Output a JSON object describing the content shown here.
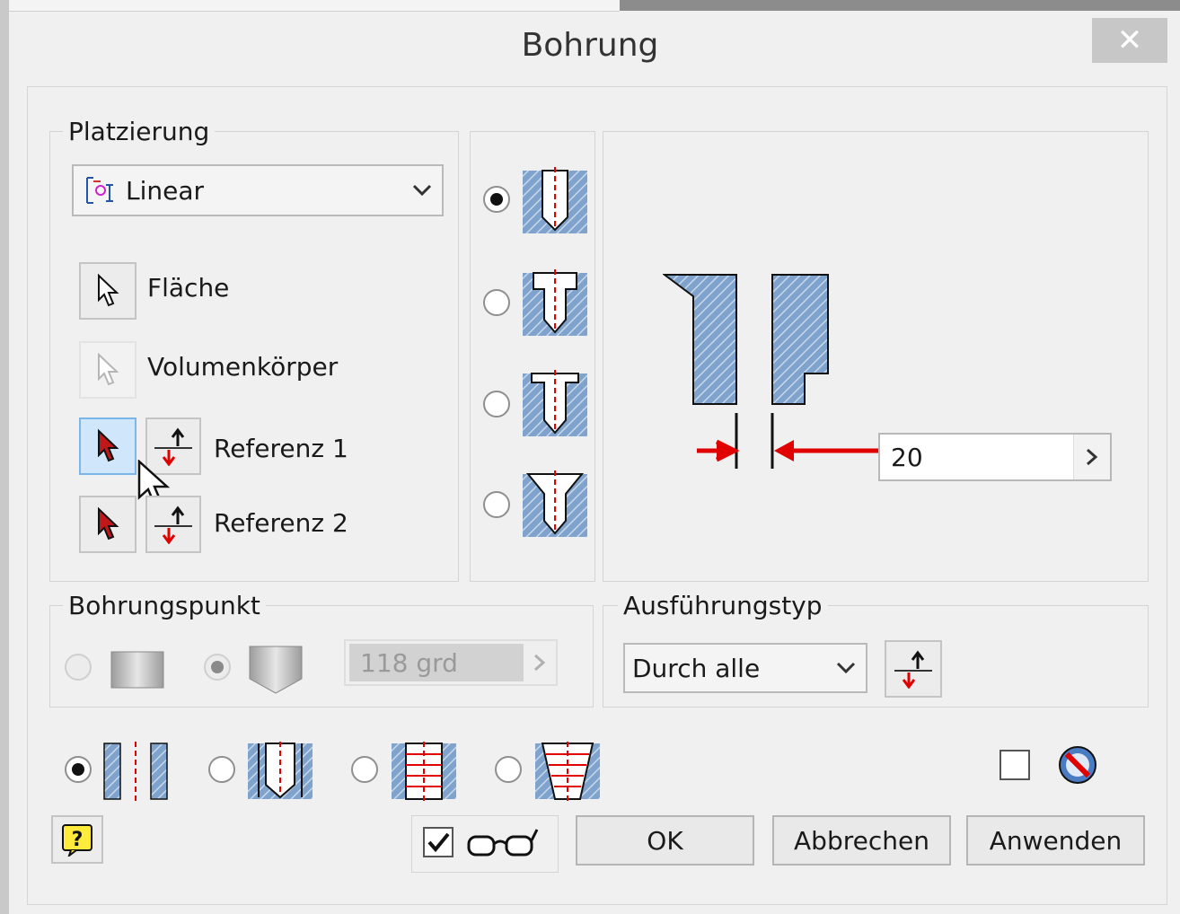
{
  "window": {
    "title": "Bohrung",
    "close_glyph": "✕"
  },
  "placement": {
    "group_label": "Platzierung",
    "method": "Linear",
    "method_icon": "linear-placement-icon",
    "face_label": "Fläche",
    "solid_label": "Volumenkörper",
    "reference1_label": "Referenz 1",
    "reference2_label": "Referenz 2"
  },
  "hole_types": [
    {
      "name": "simple-hole",
      "selected": true
    },
    {
      "name": "counterbore-hole",
      "selected": false
    },
    {
      "name": "spotface-hole",
      "selected": false
    },
    {
      "name": "countersink-hole",
      "selected": false
    }
  ],
  "preview": {
    "diameter_value": "20"
  },
  "drill_point": {
    "group_label": "Bohrungspunkt",
    "flat_selected": false,
    "angle_selected": true,
    "angle_value": "118 grd"
  },
  "termination": {
    "group_label": "Ausführungstyp",
    "value": "Durch alle"
  },
  "thread_types": [
    {
      "name": "simple",
      "selected": true
    },
    {
      "name": "clearance",
      "selected": false
    },
    {
      "name": "tapped",
      "selected": false
    },
    {
      "name": "taper-tapped",
      "selected": false
    }
  ],
  "footer": {
    "ok_label": "OK",
    "cancel_label": "Abbrechen",
    "apply_label": "Anwenden",
    "preview_checked": true,
    "ishole_checked": false
  },
  "colors": {
    "accent_red": "#e00000",
    "hatch_blue": "#7fa3cc",
    "selected_blue": "#cfe6fb"
  }
}
